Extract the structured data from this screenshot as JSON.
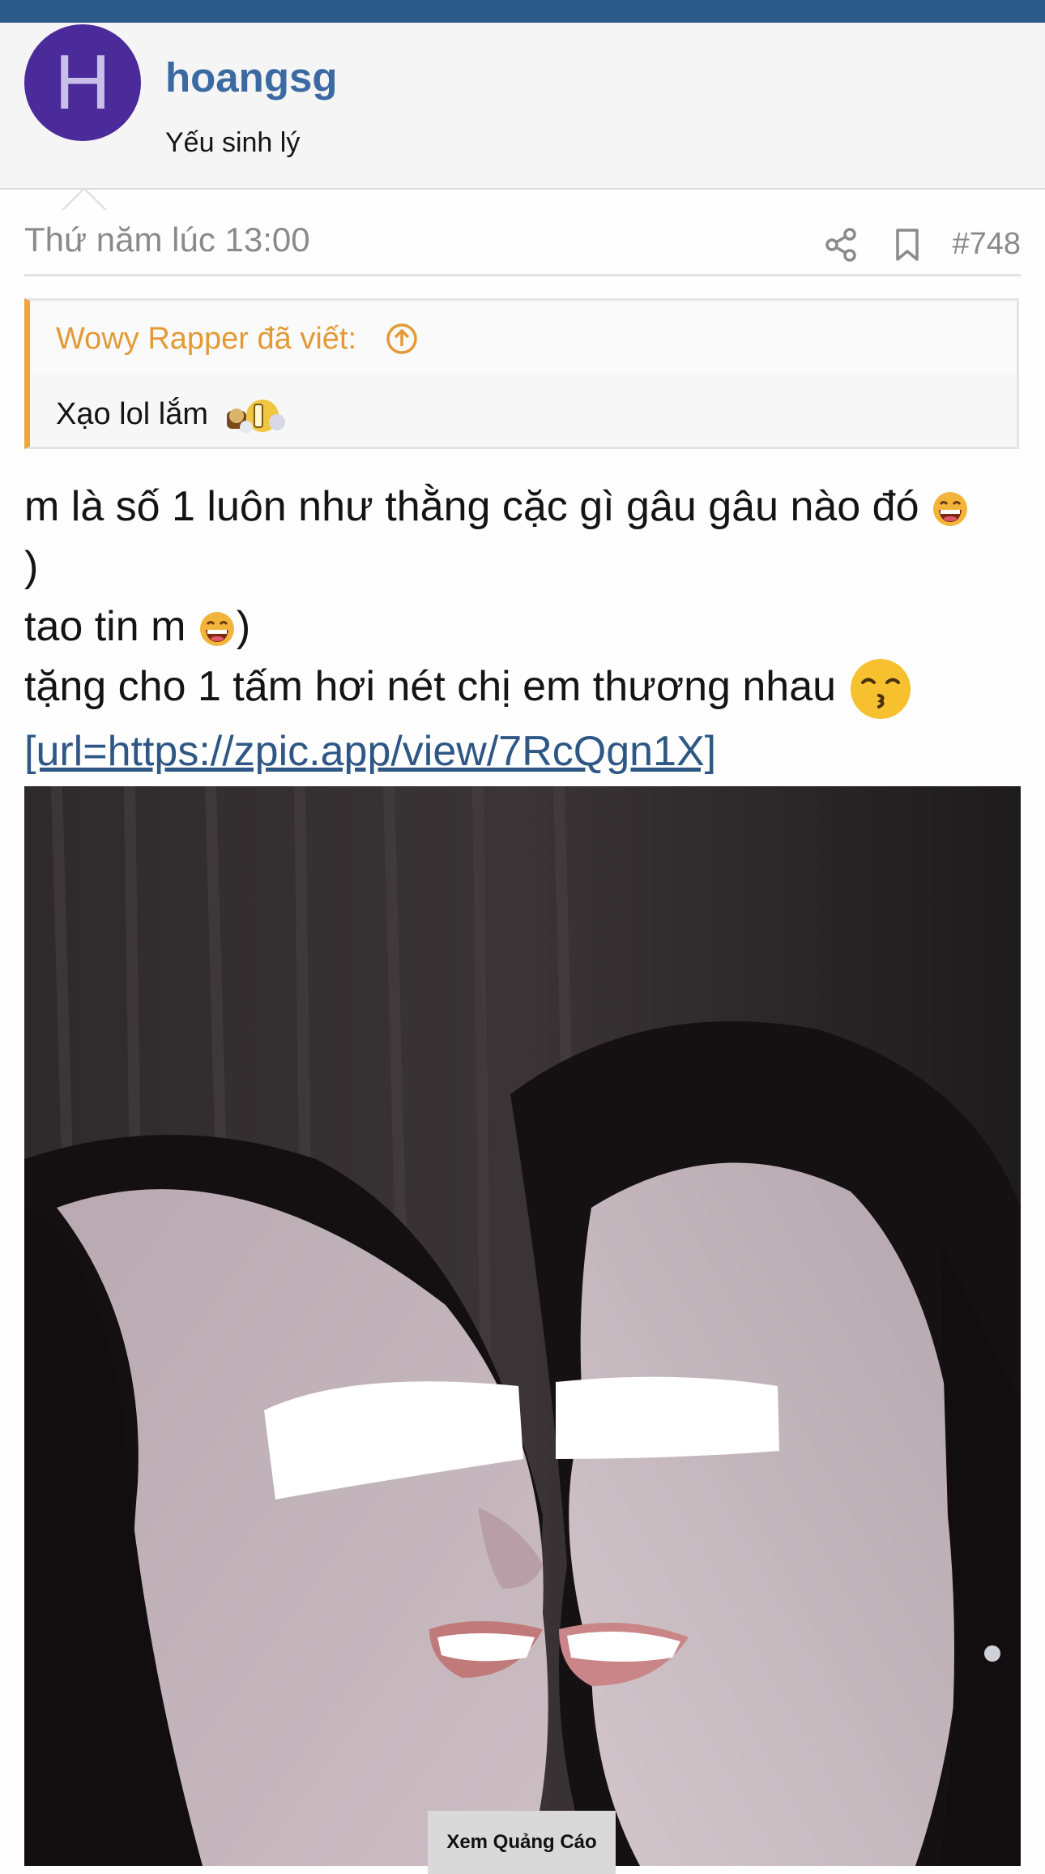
{
  "user": {
    "avatar_letter": "H",
    "name": "hoangsg",
    "title": "Yếu sinh lý"
  },
  "post": {
    "date": "Thứ năm lúc 13:00",
    "number": "#748",
    "quote": {
      "author_label": "Wowy Rapper đã viết:",
      "text": "Xạo lol lắm"
    },
    "lines": [
      "m là số 1 luôn như thằng cặc gì gâu gâu nào đó",
      ")",
      "tao tin m",
      ")",
      "tặng cho 1 tấm hơi nét chị em thương nhau"
    ],
    "link_text": "[url=https://zpic.app/view/7RcQgn1X]"
  },
  "ad": {
    "label": "Xem Quảng Cáo"
  },
  "icons": {
    "share": "share-icon",
    "bookmark": "bookmark-icon",
    "quote_up": "arrow-up-circle-icon"
  },
  "colors": {
    "topbar": "#2b5a88",
    "username": "#3b6aa2",
    "quote_accent": "#f0a53a",
    "link": "#2e5785",
    "avatar": "#4b2a9a"
  }
}
